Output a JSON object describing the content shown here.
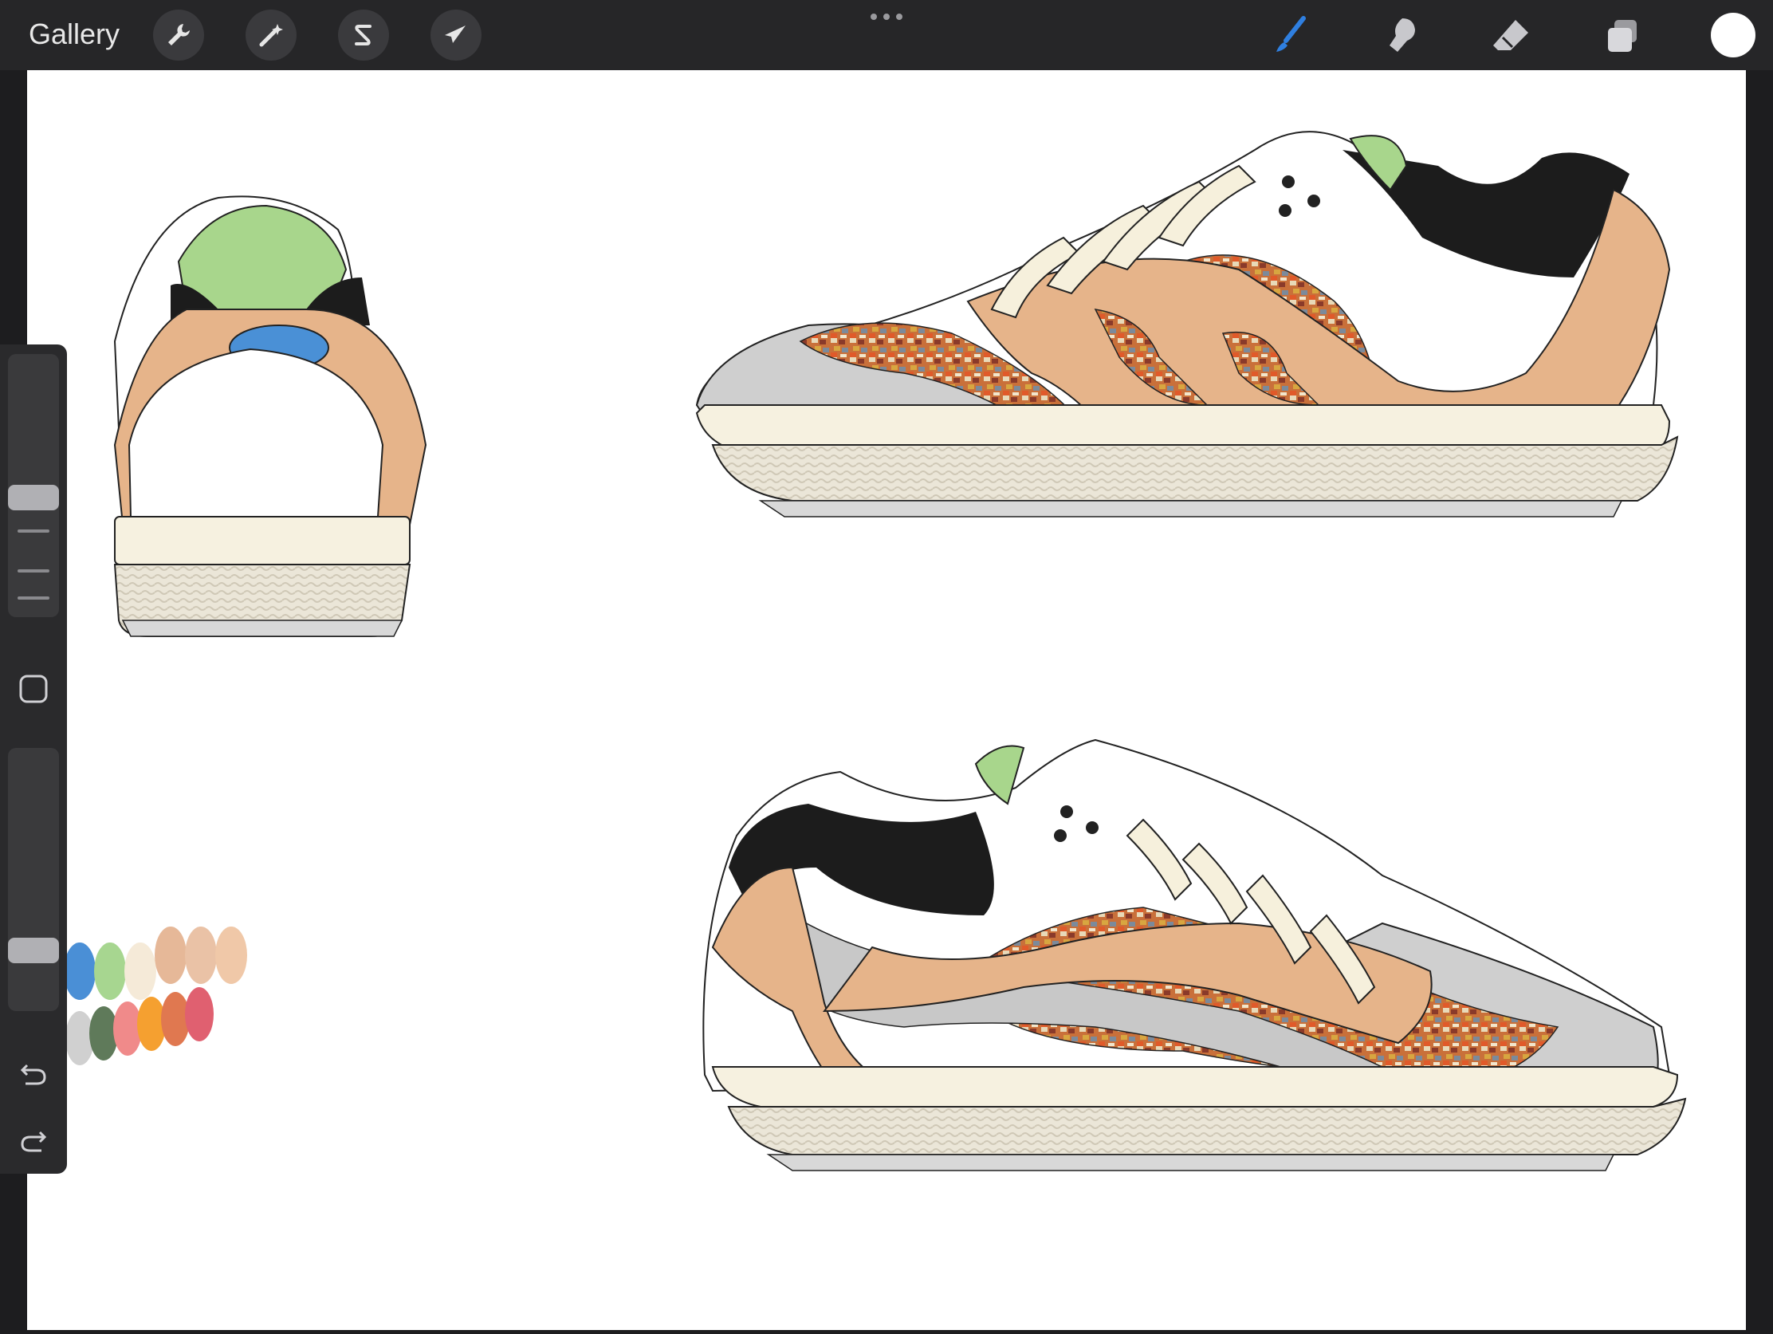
{
  "topbar": {
    "gallery_label": "Gallery",
    "left_tools": [
      {
        "name": "actions",
        "icon": "wrench-icon"
      },
      {
        "name": "adjustments",
        "icon": "magic-wand-icon"
      },
      {
        "name": "selection",
        "icon": "selection-s-icon"
      },
      {
        "name": "transform",
        "icon": "arrow-cursor-icon"
      }
    ],
    "right_tools": [
      {
        "name": "brush",
        "icon": "brush-icon",
        "active": true
      },
      {
        "name": "smudge",
        "icon": "smudge-finger-icon"
      },
      {
        "name": "eraser",
        "icon": "eraser-icon"
      },
      {
        "name": "layers",
        "icon": "layers-icon"
      }
    ],
    "current_color": "#ffffff",
    "accent_color": "#2f7fe0"
  },
  "sidebar": {
    "size_slider_level": 0.45,
    "opacity_slider_level": 0.2,
    "buttons": [
      "modify-square-icon",
      "undo-icon",
      "redo-icon"
    ]
  },
  "canvas": {
    "content": "sneaker-design-sketch",
    "palette_colors": [
      "#4a8fd6",
      "#a7d690",
      "#f5ead8",
      "#e6b898",
      "#eac2a6",
      "#f0c8a8",
      "#d0d0d0",
      "#5f7a5a",
      "#f08a8a",
      "#f5a030",
      "#e07850",
      "#e06070"
    ]
  }
}
